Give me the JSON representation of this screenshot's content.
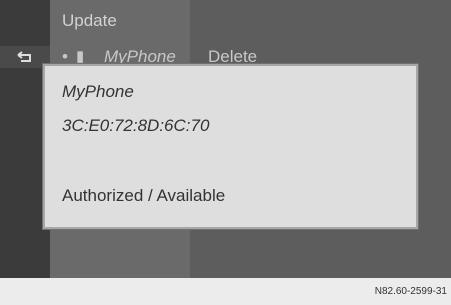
{
  "menu": {
    "update_label": "Update",
    "device_name": "MyPhone",
    "delete_label": "Delete",
    "bullet": "•",
    "phone_glyph": "▮"
  },
  "icons": {
    "back": "back-arrow-icon",
    "phone": "phone-icon"
  },
  "popup": {
    "device_name": "MyPhone",
    "address": "3C:E0:72:8D:6C:70",
    "status": "Authorized / Available"
  },
  "footer": {
    "code": "N82.60-2599-31"
  },
  "colors": {
    "screen_bg": "#5d5d5d",
    "popup_bg": "#dedede",
    "text_dark": "#333333"
  }
}
